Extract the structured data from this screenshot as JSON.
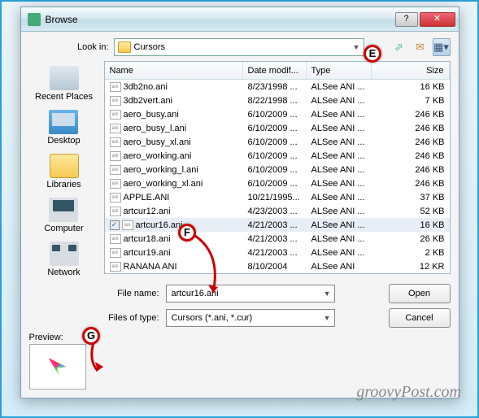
{
  "titlebar": {
    "title": "Browse"
  },
  "lookin": {
    "label": "Look in:",
    "value": "Cursors"
  },
  "nav_icons": {
    "back": "back-icon",
    "up": "up-icon",
    "newfolder": "newfolder-icon",
    "views": "views-icon"
  },
  "places": [
    {
      "label": "Recent Places",
      "ico": "ico-recent"
    },
    {
      "label": "Desktop",
      "ico": "ico-desktop"
    },
    {
      "label": "Libraries",
      "ico": "ico-lib"
    },
    {
      "label": "Computer",
      "ico": "ico-comp"
    },
    {
      "label": "Network",
      "ico": "ico-net"
    }
  ],
  "columns": {
    "name": "Name",
    "date": "Date modif...",
    "type": "Type",
    "size": "Size"
  },
  "files": [
    {
      "name": "3db2no.ani",
      "date": "8/23/1998 ...",
      "type": "ALSee ANI ...",
      "size": "16 KB"
    },
    {
      "name": "3db2vert.ani",
      "date": "8/22/1998 ...",
      "type": "ALSee ANI ...",
      "size": "7 KB"
    },
    {
      "name": "aero_busy.ani",
      "date": "6/10/2009 ...",
      "type": "ALSee ANI ...",
      "size": "246 KB"
    },
    {
      "name": "aero_busy_l.ani",
      "date": "6/10/2009 ...",
      "type": "ALSee ANI ...",
      "size": "246 KB"
    },
    {
      "name": "aero_busy_xl.ani",
      "date": "6/10/2009 ...",
      "type": "ALSee ANI ...",
      "size": "246 KB"
    },
    {
      "name": "aero_working.ani",
      "date": "6/10/2009 ...",
      "type": "ALSee ANI ...",
      "size": "246 KB"
    },
    {
      "name": "aero_working_l.ani",
      "date": "6/10/2009 ...",
      "type": "ALSee ANI ...",
      "size": "246 KB"
    },
    {
      "name": "aero_working_xl.ani",
      "date": "6/10/2009 ...",
      "type": "ALSee ANI ...",
      "size": "246 KB"
    },
    {
      "name": "APPLE.ANI",
      "date": "10/21/1995...",
      "type": "ALSee ANI ...",
      "size": "37 KB"
    },
    {
      "name": "artcur12.ani",
      "date": "4/23/2003 ...",
      "type": "ALSee ANI ...",
      "size": "52 KB"
    },
    {
      "name": "artcur16.ani",
      "date": "4/21/2003 ...",
      "type": "ALSee ANI ...",
      "size": "16 KB",
      "selected": true,
      "checked": true
    },
    {
      "name": "artcur18.ani",
      "date": "4/21/2003 ...",
      "type": "ALSee ANI ...",
      "size": "26 KB"
    },
    {
      "name": "artcur19.ani",
      "date": "4/21/2003 ...",
      "type": "ALSee ANI ...",
      "size": "2 KB"
    },
    {
      "name": "RANANA ANI",
      "date": "8/10/2004",
      "type": "ALSee ANI",
      "size": "12 KR"
    }
  ],
  "filename": {
    "label": "File name:",
    "value": "artcur16.ani"
  },
  "filetype": {
    "label": "Files of type:",
    "value": "Cursors (*.ani, *.cur)"
  },
  "buttons": {
    "open": "Open",
    "cancel": "Cancel"
  },
  "preview": {
    "label": "Preview:"
  },
  "callouts": {
    "E": "E",
    "F": "F",
    "G": "G"
  },
  "watermark": "groovyPost.com"
}
